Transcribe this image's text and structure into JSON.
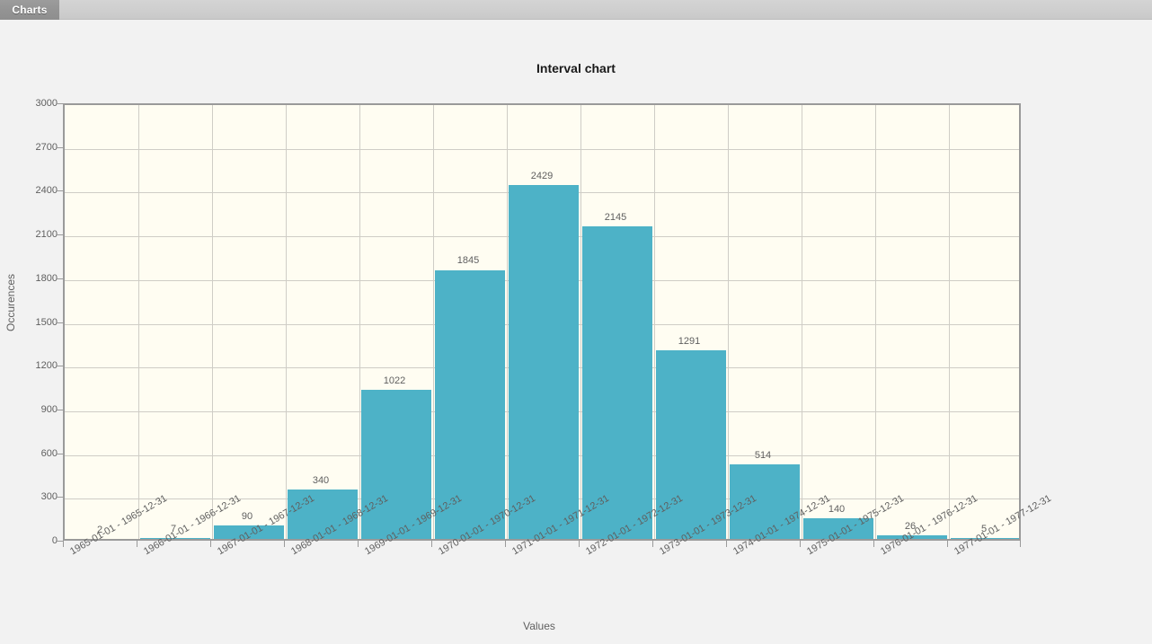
{
  "tabs": [
    {
      "label": "Charts",
      "active": true
    }
  ],
  "chart_data": {
    "type": "bar",
    "title": "Interval chart",
    "xlabel": "Values",
    "ylabel": "Occurences",
    "ylim": [
      0,
      3000
    ],
    "ytick_step": 300,
    "yticks": [
      0,
      300,
      600,
      900,
      1200,
      1500,
      1800,
      2100,
      2400,
      2700,
      3000
    ],
    "grid": true,
    "legend": null,
    "bar_color": "#4db2c7",
    "plot_background": "#fffdf2",
    "gridline_color": "#cfcdc6",
    "axis_color": "#9a9a9a",
    "show_value_labels": true,
    "categories": [
      "1965-01-01 - 1965-12-31",
      "1966-01-01 - 1966-12-31",
      "1967-01-01 - 1967-12-31",
      "1968-01-01 - 1968-12-31",
      "1969-01-01 - 1969-12-31",
      "1970-01-01 - 1970-12-31",
      "1971-01-01 - 1971-12-31",
      "1972-01-01 - 1972-12-31",
      "1973-01-01 - 1973-12-31",
      "1974-01-01 - 1974-12-31",
      "1975-01-01 - 1975-12-31",
      "1976-01-01 - 1976-12-31",
      "1977-01-01 - 1977-12-31"
    ],
    "values": [
      2,
      7,
      90,
      340,
      1022,
      1845,
      2429,
      2145,
      1291,
      514,
      140,
      26,
      5
    ]
  }
}
